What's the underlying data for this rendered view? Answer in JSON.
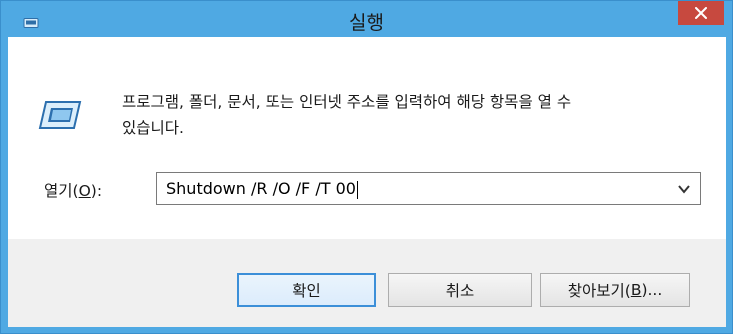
{
  "window": {
    "title": "실행"
  },
  "content": {
    "description_line1": "프로그램, 폴더, 문서, 또는 인터넷 주소를 입력하여 해당 항목을 열 수",
    "description_line2": "있습니다."
  },
  "open_field": {
    "label_prefix": "열기(",
    "label_accel": "O",
    "label_suffix": "):",
    "value": "Shutdown /R /O /F /T 00"
  },
  "buttons": {
    "ok_label": "확인",
    "cancel_label": "취소",
    "browse_prefix": "찾아보기(",
    "browse_accel": "B",
    "browse_suffix": ")..."
  },
  "colors": {
    "titlebar": "#4fa9e3",
    "close": "#c7493f",
    "focus_border": "#3c8fd8"
  },
  "icons": {
    "app": "run-dialog-icon",
    "close": "close-icon",
    "dropdown": "chevron-down-icon"
  }
}
